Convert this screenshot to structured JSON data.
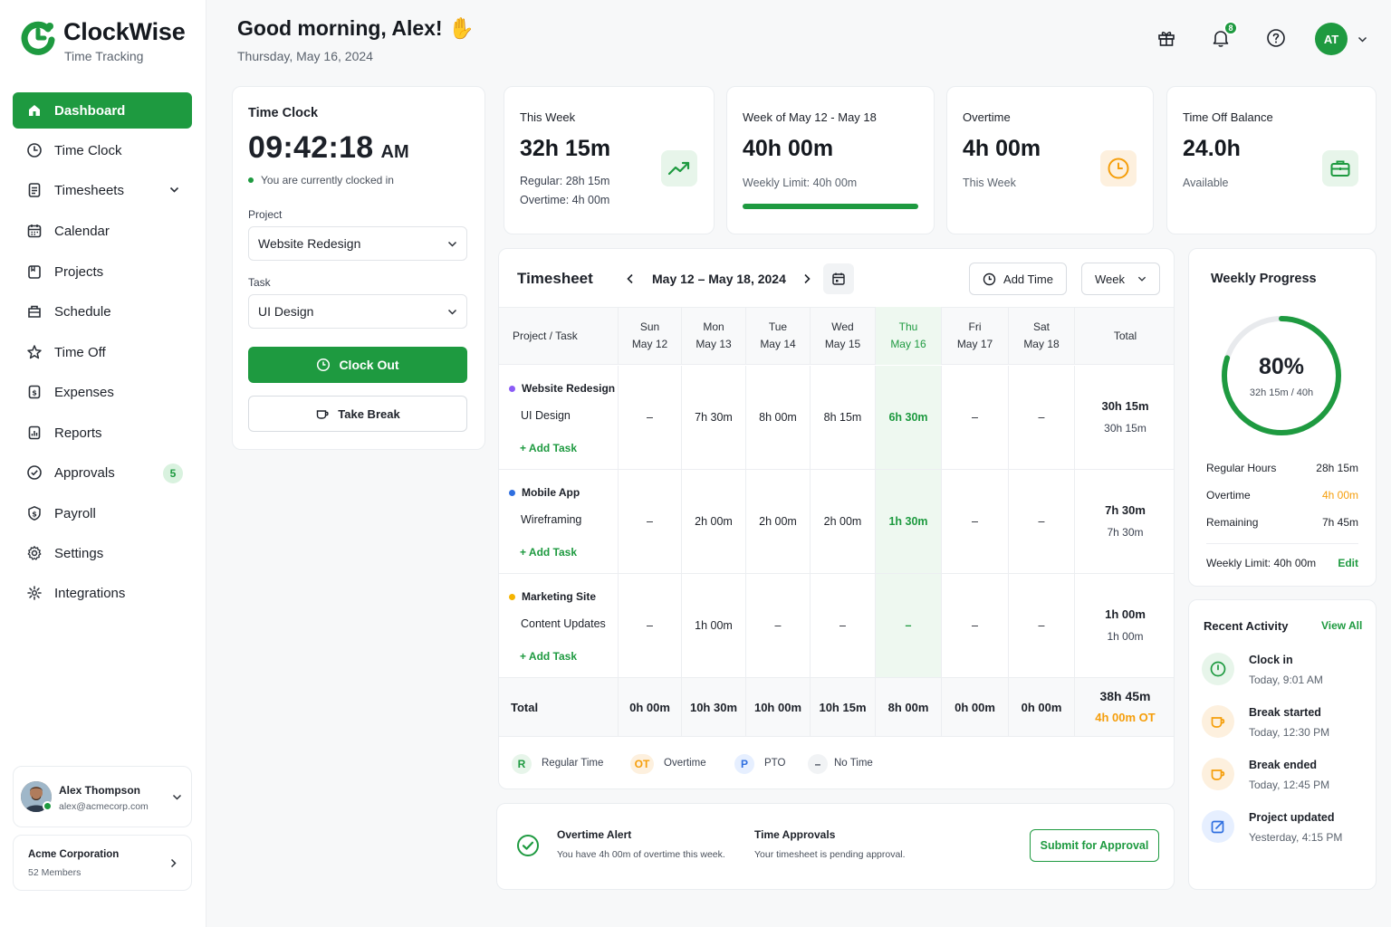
{
  "app": {
    "name": "ClockWise",
    "subtitle": "Time Tracking"
  },
  "sidebar": {
    "items": [
      {
        "label": "Dashboard",
        "icon": "home-icon"
      },
      {
        "label": "Time Clock",
        "icon": "clock-icon"
      },
      {
        "label": "Timesheets",
        "icon": "document-icon"
      },
      {
        "label": "Calendar",
        "icon": "calendar-icon"
      },
      {
        "label": "Projects",
        "icon": "folder-icon"
      },
      {
        "label": "Schedule",
        "icon": "schedule-icon"
      },
      {
        "label": "Time Off",
        "icon": "star-icon"
      },
      {
        "label": "Expenses",
        "icon": "receipt-icon"
      },
      {
        "label": "Reports",
        "icon": "report-icon"
      },
      {
        "label": "Approvals",
        "icon": "check-circle-icon",
        "badge": "5"
      },
      {
        "label": "Payroll",
        "icon": "dollar-icon"
      },
      {
        "label": "Settings",
        "icon": "gear-icon"
      },
      {
        "label": "Integrations",
        "icon": "puzzle-icon"
      }
    ],
    "user": {
      "name": "Alex Thompson",
      "email": "alex@acmecorp.com"
    },
    "org": {
      "name": "Acme Corporation",
      "members": "52 Members"
    }
  },
  "header": {
    "greeting": "Good morning, Alex!",
    "date": "Thursday, May 16, 2024",
    "notifications": "8",
    "avatar_initials": "AT"
  },
  "time_clock": {
    "title": "Time Clock",
    "time": "09:42:18",
    "ampm": "AM",
    "status": "You are currently clocked in",
    "project_label": "Project",
    "project_value": "Website Redesign",
    "task_label": "Task",
    "task_value": "UI Design",
    "clock_out": "Clock Out",
    "take_break": "Take Break"
  },
  "stats": {
    "this_week": {
      "label": "This Week",
      "value": "32h 15m",
      "regular": "Regular: 28h 15m",
      "overtime": "Overtime: 4h 00m"
    },
    "week_range": {
      "label": "Week of May 12 - May 18",
      "value": "40h 00m",
      "limit": "Weekly Limit: 40h 00m",
      "progress": 1.0
    },
    "overtime": {
      "label": "Overtime",
      "value": "4h 00m",
      "sub": "This Week"
    },
    "time_off": {
      "label": "Time Off Balance",
      "value": "24.0h",
      "sub": "Available"
    }
  },
  "timesheet": {
    "title": "Timesheet",
    "range": "May 12 – May 18, 2024",
    "add_time": "Add Time",
    "view": "Week",
    "col_project": "Project / Task",
    "col_total": "Total",
    "days": [
      {
        "d": "Sun",
        "date": "May 12"
      },
      {
        "d": "Mon",
        "date": "May 13"
      },
      {
        "d": "Tue",
        "date": "May 14"
      },
      {
        "d": "Wed",
        "date": "May 15"
      },
      {
        "d": "Thu",
        "date": "May 16"
      },
      {
        "d": "Fri",
        "date": "May 17"
      },
      {
        "d": "Sat",
        "date": "May 18"
      }
    ],
    "rows": [
      {
        "project": "Website Redesign",
        "color": "#8b5cf6",
        "task": "UI Design",
        "add": "+ Add Task",
        "values": [
          "–",
          "7h 30m",
          "8h 00m",
          "8h 15m",
          "6h 30m",
          "–",
          "–"
        ],
        "total": "30h 15m",
        "subtotal": "30h 15m"
      },
      {
        "project": "Mobile App",
        "color": "#2f6fe0",
        "task": "Wireframing",
        "add": "+ Add Task",
        "values": [
          "–",
          "2h 00m",
          "2h 00m",
          "2h 00m",
          "1h 30m",
          "–",
          "–"
        ],
        "total": "7h 30m",
        "subtotal": "7h 30m"
      },
      {
        "project": "Marketing Site",
        "color": "#f5b400",
        "task": "Content Updates",
        "add": "+ Add Task",
        "values": [
          "–",
          "1h 00m",
          "–",
          "–",
          "–",
          "–",
          "–"
        ],
        "total": "1h 00m",
        "subtotal": "1h 00m"
      }
    ],
    "totals": {
      "label": "Total",
      "values": [
        "0h 00m",
        "10h 30m",
        "10h 00m",
        "10h 15m",
        "8h 00m",
        "0h 00m",
        "0h 00m"
      ],
      "total": "38h 45m",
      "ot": "4h 00m OT"
    },
    "legend": [
      {
        "badge": "R",
        "label": "Regular Time"
      },
      {
        "badge": "OT",
        "label": "Overtime"
      },
      {
        "badge": "P",
        "label": "PTO"
      },
      {
        "badge": "–",
        "label": "No Time"
      }
    ]
  },
  "alerts": {
    "overtime_title": "Overtime Alert",
    "overtime_text": "You have 4h 00m of overtime this week.",
    "approval_title": "Time Approvals",
    "approval_text": "Your timesheet is pending approval.",
    "submit": "Submit for Approval"
  },
  "weekly_progress": {
    "title": "Weekly Progress",
    "percent_label": "80%",
    "percent": 0.8,
    "sub": "32h 15m / 40h",
    "rows": [
      {
        "label": "Regular Hours",
        "value": "28h 15m"
      },
      {
        "label": "Overtime",
        "value": "4h 00m"
      },
      {
        "label": "Remaining",
        "value": "7h 45m"
      }
    ],
    "limit": "Weekly Limit: 40h 00m",
    "edit": "Edit"
  },
  "activity": {
    "title": "Recent Activity",
    "view_all": "View All",
    "items": [
      {
        "title": "Clock in",
        "time": "Today, 9:01 AM"
      },
      {
        "title": "Break started",
        "time": "Today, 12:30 PM"
      },
      {
        "title": "Break ended",
        "time": "Today, 12:45 PM"
      },
      {
        "title": "Project updated",
        "time": "Yesterday, 4:15 PM"
      }
    ]
  },
  "colors": {
    "brand": "#1e9a40",
    "orange": "#f59e0b",
    "blue": "#2f6fe0",
    "highlight": "#eef8f0"
  }
}
